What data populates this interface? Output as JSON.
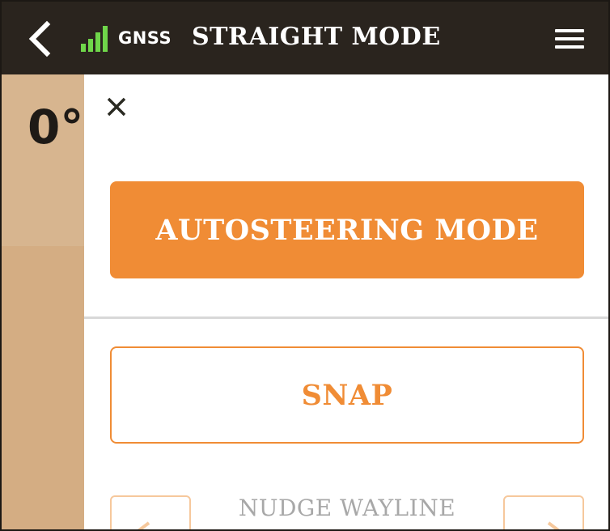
{
  "header": {
    "signal_label": "GNSS",
    "title": "STRAIGHT MODE"
  },
  "side": {
    "angle": "0°"
  },
  "panel": {
    "autosteering_label": "AUTOSTEERING MODE",
    "snap_label": "SNAP",
    "nudge_label": "NUDGE WAYLINE"
  },
  "colors": {
    "header_bg": "#2a241e",
    "accent_orange": "#f08c35",
    "side_strip": "#d4ad83",
    "signal_green": "#6fd64a"
  },
  "icons": {
    "back": "chevron-left-icon",
    "signal": "signal-bars-icon",
    "menu": "hamburger-menu-icon",
    "close": "close-icon",
    "nudge_left": "arrow-left-icon",
    "nudge_right": "arrow-right-icon"
  }
}
